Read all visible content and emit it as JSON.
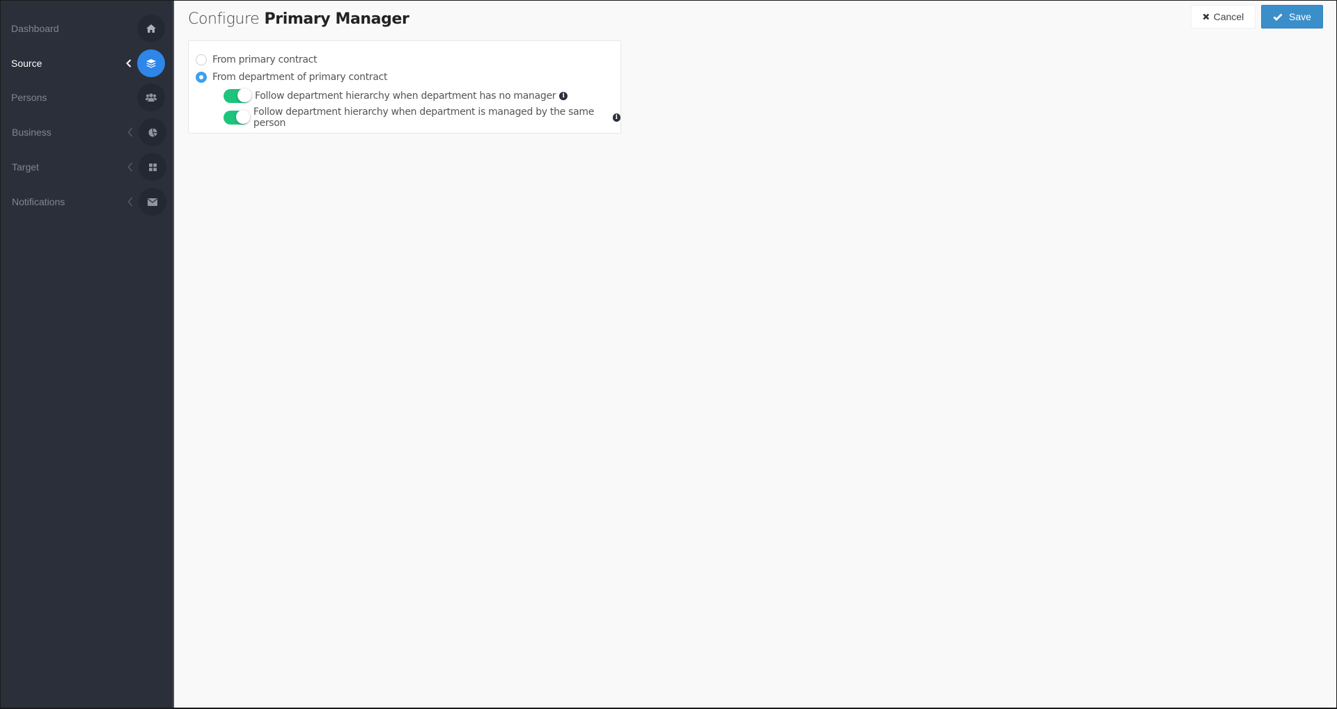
{
  "sidebar": {
    "items": [
      {
        "label": "Dashboard",
        "icon": "home-icon",
        "active": false,
        "has_chevron": false
      },
      {
        "label": "Source",
        "icon": "layers-icon",
        "active": true,
        "has_chevron": true
      },
      {
        "label": "Persons",
        "icon": "users-icon",
        "active": false,
        "has_chevron": false
      },
      {
        "label": "Business",
        "icon": "pie-chart-icon",
        "active": false,
        "has_chevron": true
      },
      {
        "label": "Target",
        "icon": "grid-icon",
        "active": false,
        "has_chevron": true
      },
      {
        "label": "Notifications",
        "icon": "envelope-icon",
        "active": false,
        "has_chevron": true
      }
    ]
  },
  "header": {
    "title_prefix": "Configure",
    "title_main": "Primary Manager",
    "cancel_label": "Cancel",
    "save_label": "Save"
  },
  "form": {
    "options": [
      {
        "label": "From primary contract",
        "checked": false
      },
      {
        "label": "From department of primary contract",
        "checked": true
      }
    ],
    "toggles": [
      {
        "label": "Follow department hierarchy when department has no manager",
        "on": true,
        "info_icon": "info-icon"
      },
      {
        "label": "Follow department hierarchy when department is managed by the same person",
        "on": true,
        "info_icon": "info-icon"
      }
    ]
  },
  "colors": {
    "sidebar_bg": "#2b2f3a",
    "active_accent": "#2e86e8",
    "save_button": "#3a8fcb",
    "toggle_on": "#1ec47c",
    "radio_checked": "#3d9ff0"
  }
}
